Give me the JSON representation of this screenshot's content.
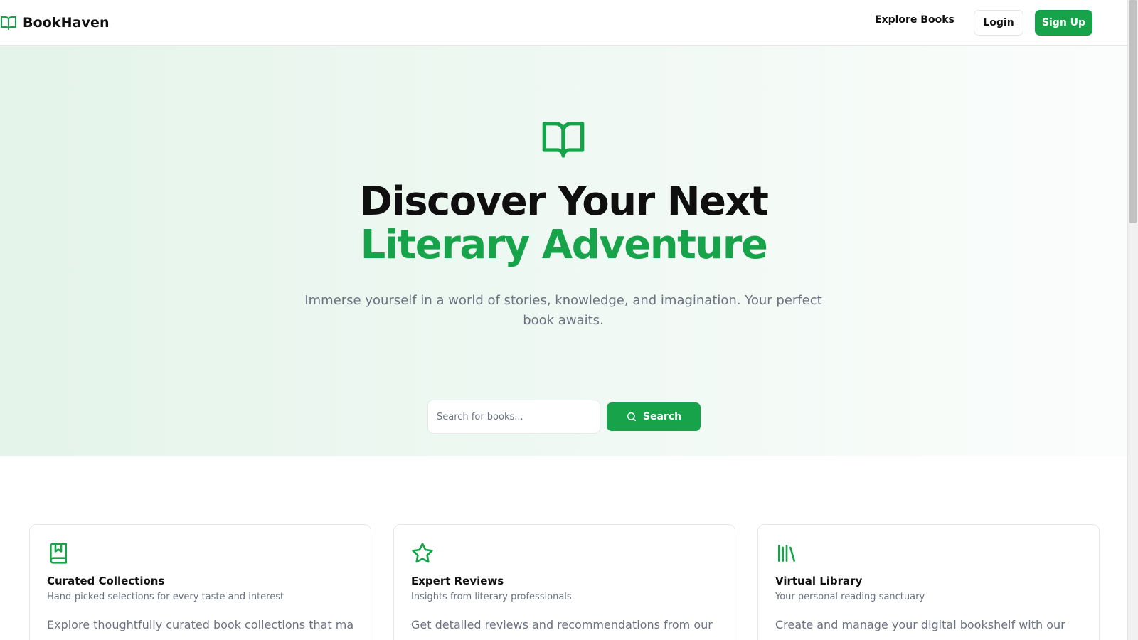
{
  "nav": {
    "brand": "BookHaven",
    "brand_icon": "book-open-icon",
    "explore_label": "Explore Books",
    "login_label": "Login",
    "signup_label": "Sign Up"
  },
  "hero": {
    "icon": "book-open-icon",
    "title_main": "Discover Your Next ",
    "title_accent": "Literary Adventure",
    "subtitle": "Immerse yourself in a world of stories, knowledge, and imagination. Your perfect book awaits.",
    "search_placeholder": "Search for books...",
    "search_value": "",
    "search_button": "Search",
    "search_icon": "search-icon"
  },
  "features": [
    {
      "icon": "bookmark-book-icon",
      "title": "Curated Collections",
      "subtitle": "Hand-picked selections for every taste and interest",
      "body": "Explore thoughtfully curated book collections that match"
    },
    {
      "icon": "star-icon",
      "title": "Expert Reviews",
      "subtitle": "Insights from literary professionals",
      "body": "Get detailed reviews and recommendations from our"
    },
    {
      "icon": "library-icon",
      "title": "Virtual Library",
      "subtitle": "Your personal reading sanctuary",
      "body": "Create and manage your digital bookshelf with our"
    }
  ],
  "colors": {
    "accent": "#16a34a",
    "text": "#111111",
    "muted": "#6b7280",
    "border": "#e5e7eb"
  }
}
